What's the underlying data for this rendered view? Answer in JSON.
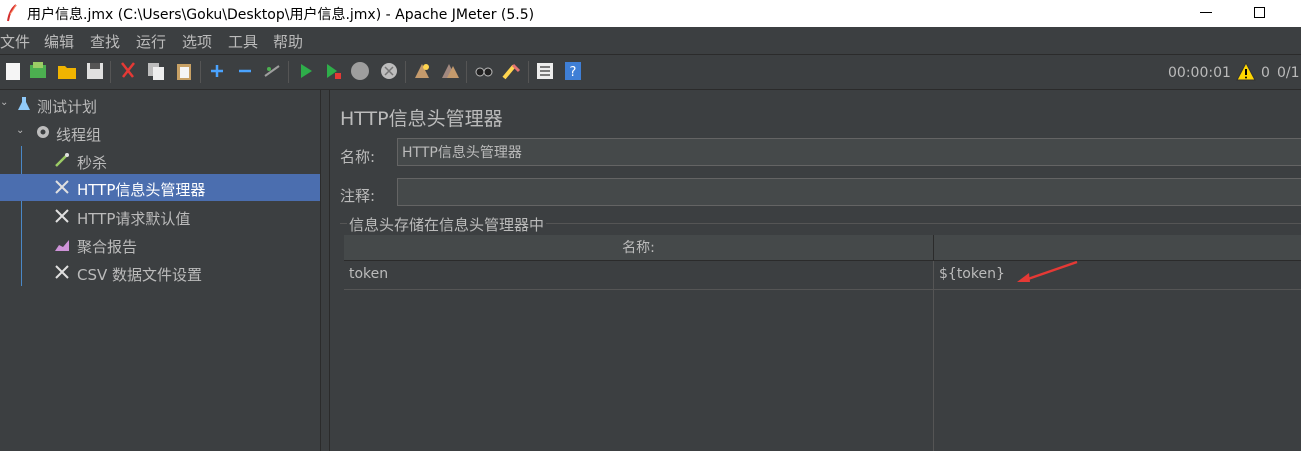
{
  "window": {
    "title": "用户信息.jmx (C:\\Users\\Goku\\Desktop\\用户信息.jmx) - Apache JMeter (5.5)"
  },
  "menu": [
    "文件",
    "编辑",
    "查找",
    "运行",
    "选项",
    "工具",
    "帮助"
  ],
  "toolbar": {
    "icons": [
      "new-icon",
      "templates-icon",
      "open-icon",
      "save-icon",
      "cut-icon",
      "copy-icon",
      "paste-icon",
      "expand-icon",
      "collapse-icon",
      "toggle-icon",
      "start-icon",
      "start-no-pause-icon",
      "stop-icon",
      "shutdown-icon",
      "clear-icon",
      "clear-all-icon",
      "search-icon",
      "reset-search-icon",
      "function-helper-icon",
      "help-icon"
    ],
    "timer": "00:00:01",
    "warning_count": "0",
    "threads": "0/1"
  },
  "tree": {
    "items": [
      {
        "label": "测试计划",
        "icon": "flask-icon"
      },
      {
        "label": "线程组",
        "icon": "gear-icon"
      },
      {
        "label": "秒杀",
        "icon": "pipette-icon"
      },
      {
        "label": "HTTP信息头管理器",
        "icon": "wrench-icon"
      },
      {
        "label": "HTTP请求默认值",
        "icon": "wrench-icon"
      },
      {
        "label": "聚合报告",
        "icon": "chart-icon"
      },
      {
        "label": "CSV 数据文件设置",
        "icon": "wrench-icon"
      }
    ]
  },
  "panel": {
    "title": "HTTP信息头管理器",
    "name_label": "名称:",
    "name_value": "HTTP信息头管理器",
    "comment_label": "注释:",
    "comment_value": "",
    "group_title": "信息头存储在信息头管理器中",
    "table": {
      "headers": [
        "名称:",
        ""
      ],
      "rows": [
        {
          "name": "token",
          "value": "${token}"
        }
      ]
    }
  },
  "colors": {
    "background": "#3c3f41",
    "selection": "#4b6eaf",
    "annotation_arrow": "#e53935"
  }
}
